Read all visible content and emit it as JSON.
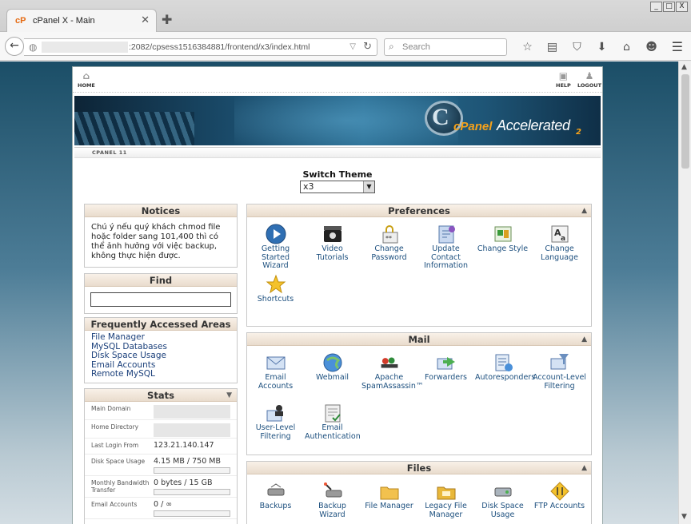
{
  "browser": {
    "tab_title": "cPanel X - Main",
    "tab_favicon": "cP",
    "url": ":2082/cpsess1516384881/frontend/x3/index.html",
    "search_placeholder": "Search",
    "window_buttons": [
      "_",
      "□",
      "X"
    ]
  },
  "top_links": {
    "home": "HOME",
    "help": "HELP",
    "logout": "LOGOUT"
  },
  "banner": {
    "brand_cpanel": "cPanel",
    "brand_accelerated": "Accelerated",
    "brand_version": "2"
  },
  "subbar_label": "CPANEL 11",
  "theme": {
    "label": "Switch Theme",
    "selected": "x3"
  },
  "notices": {
    "title": "Notices",
    "text": "Chú ý nếu quý khách chmod file hoặc folder sang 101,400 thì có thể ảnh hưởng với việc backup, không thực hiện được."
  },
  "find": {
    "title": "Find"
  },
  "faa": {
    "title": "Frequently Accessed Areas",
    "links": [
      "File Manager",
      "MySQL Databases",
      "Disk Space Usage",
      "Email Accounts",
      "Remote MySQL"
    ]
  },
  "stats": {
    "title": "Stats",
    "rows": [
      {
        "label": "Main Domain",
        "value": ""
      },
      {
        "label": "Home Directory",
        "value": ""
      },
      {
        "label": "Last Login From",
        "value": "123.21.140.147"
      },
      {
        "label": "Disk Space Usage",
        "value": "4.15 MB / 750 MB"
      },
      {
        "label": "Monthly Bandwidth Transfer",
        "value": "0 bytes / 15 GB"
      },
      {
        "label": "Email Accounts",
        "value": "0 / ∞"
      }
    ]
  },
  "preferences": {
    "title": "Preferences",
    "items": [
      {
        "label": "Getting Started Wizard",
        "icon": "play-icon"
      },
      {
        "label": "Video Tutorials",
        "icon": "film-icon"
      },
      {
        "label": "Change Password",
        "icon": "lock-icon"
      },
      {
        "label": "Update Contact Information",
        "icon": "contact-icon"
      },
      {
        "label": "Change Style",
        "icon": "palette-icon"
      },
      {
        "label": "Change Language",
        "icon": "language-icon"
      },
      {
        "label": "Shortcuts",
        "icon": "star-icon"
      }
    ]
  },
  "mail": {
    "title": "Mail",
    "items": [
      {
        "label": "Email Accounts",
        "icon": "envelope-icon"
      },
      {
        "label": "Webmail",
        "icon": "globe-mail-icon"
      },
      {
        "label": "Apache SpamAssassin™",
        "icon": "spamassassin-icon"
      },
      {
        "label": "Forwarders",
        "icon": "forward-icon"
      },
      {
        "label": "Autoresponders",
        "icon": "autoresponder-icon"
      },
      {
        "label": "Account-Level Filtering",
        "icon": "filter-icon"
      },
      {
        "label": "User-Level Filtering",
        "icon": "user-filter-icon"
      },
      {
        "label": "Email Authentication",
        "icon": "auth-icon"
      }
    ]
  },
  "files": {
    "title": "Files",
    "items": [
      {
        "label": "Backups",
        "icon": "backup-icon"
      },
      {
        "label": "Backup Wizard",
        "icon": "backup-wizard-icon"
      },
      {
        "label": "File Manager",
        "icon": "folder-icon"
      },
      {
        "label": "Legacy File Manager",
        "icon": "legacy-folder-icon"
      },
      {
        "label": "Disk Space Usage",
        "icon": "disk-icon"
      },
      {
        "label": "FTP Accounts",
        "icon": "ftp-icon"
      }
    ]
  }
}
